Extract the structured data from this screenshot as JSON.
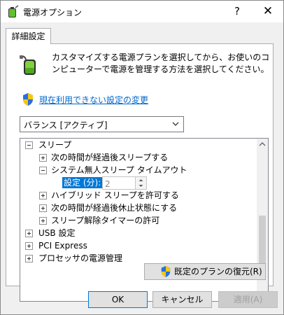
{
  "window": {
    "title": "電源オプション",
    "help_label": "?",
    "close_label": "✕"
  },
  "tab": {
    "label": "詳細設定"
  },
  "description": "カスタマイズする電源プランを選択してから、お使いのコンピューターで電源を管理する方法を選択してください。",
  "link": {
    "label": "現在利用できない設定の変更"
  },
  "plan_select": {
    "value": "バランス [アクティブ]"
  },
  "tree": {
    "items": [
      {
        "label": "スリープ",
        "expanded": true
      },
      {
        "label": "次の時間が経過後スリープする",
        "expanded": false
      },
      {
        "label": "システム無人スリープ タイムアウト",
        "expanded": true
      },
      {
        "label": "ハイブリッド スリープを許可する",
        "expanded": false
      },
      {
        "label": "次の時間が経過後休止状態にする",
        "expanded": false
      },
      {
        "label": "スリープ解除タイマーの許可",
        "expanded": false
      },
      {
        "label": "USB 設定",
        "expanded": false
      },
      {
        "label": "PCI Express",
        "expanded": false
      },
      {
        "label": "プロセッサの電源管理",
        "expanded": false
      }
    ],
    "setting": {
      "label": "設定 (分):",
      "value": "2"
    }
  },
  "buttons": {
    "restore": "既定のプランの復元(R)",
    "ok": "OK",
    "cancel": "キャンセル",
    "apply": "適用(A)"
  },
  "colors": {
    "selection": "#0078d7",
    "link": "#0066cc",
    "disabled_text": "#a0a0a0"
  },
  "icons": {
    "app": "battery-power-icon",
    "panel": "battery-plug-icon",
    "link": "uac-shield-icon",
    "restore": "uac-shield-icon"
  }
}
